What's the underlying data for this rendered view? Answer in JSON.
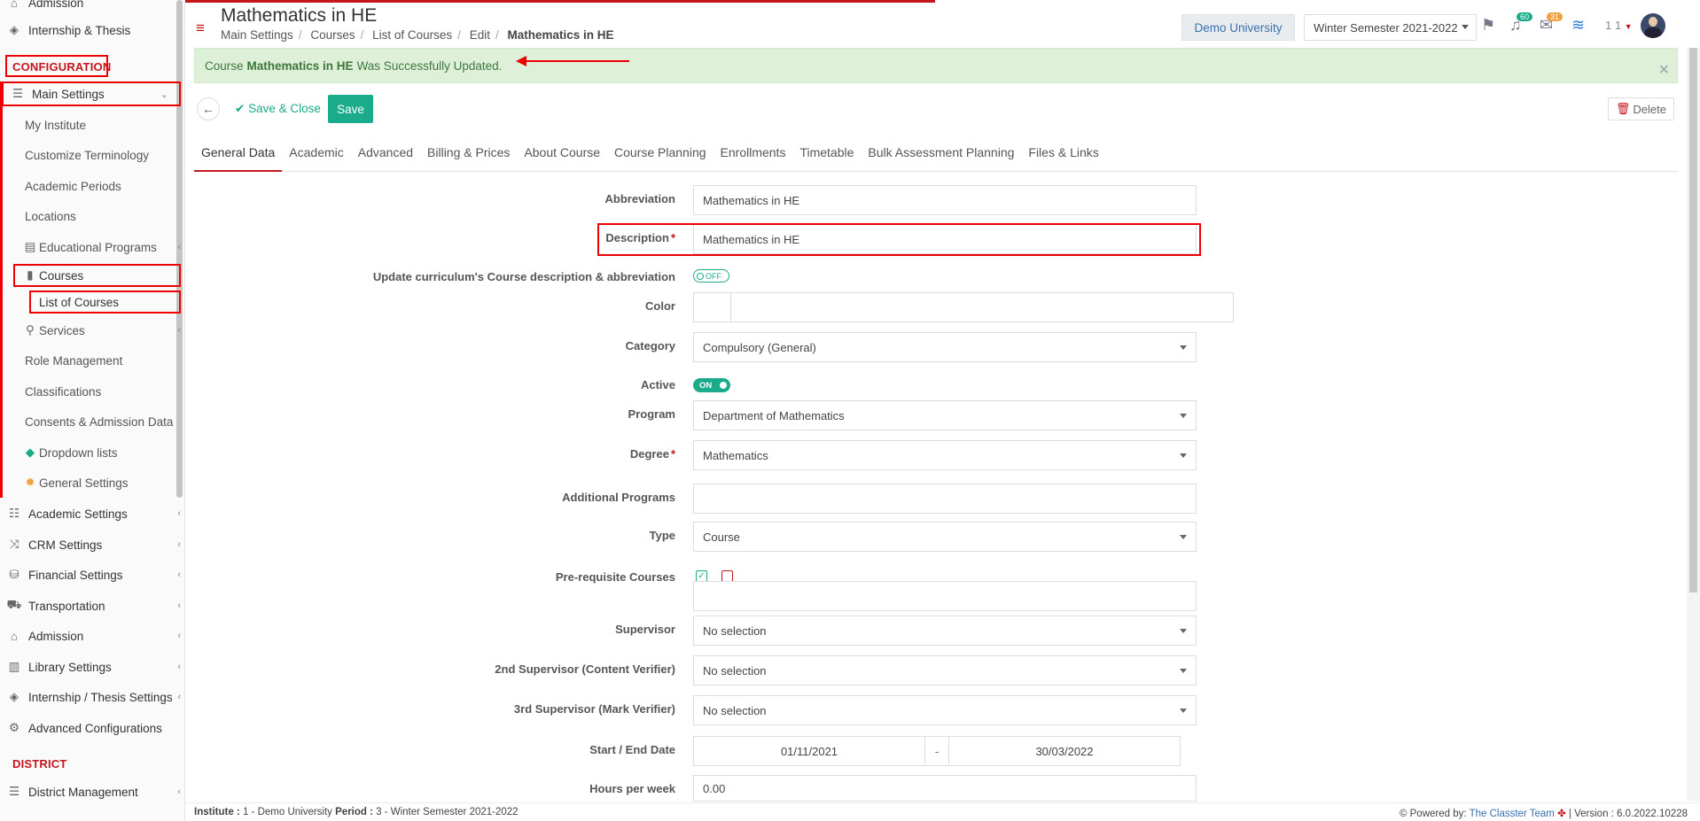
{
  "sidebar": {
    "top_partial": "Admission",
    "internship_thesis": "Internship & Thesis",
    "config_heading": "CONFIGURATION",
    "main_settings": "Main Settings",
    "items": {
      "my_institute": "My Institute",
      "customize_terminology": "Customize Terminology",
      "academic_periods": "Academic Periods",
      "locations": "Locations",
      "educational_programs": "Educational Programs",
      "courses": "Courses",
      "list_of_courses": "List of Courses",
      "services": "Services",
      "role_management": "Role Management",
      "classifications": "Classifications",
      "consents": "Consents & Admission Data",
      "dropdown_lists": "Dropdown lists",
      "general_settings": "General Settings"
    },
    "groups": {
      "academic_settings": "Academic Settings",
      "crm_settings": "CRM Settings",
      "financial_settings": "Financial Settings",
      "transportation": "Transportation",
      "admission": "Admission",
      "library_settings": "Library Settings",
      "internship_thesis_settings": "Internship / Thesis Settings",
      "advanced_configurations": "Advanced Configurations"
    },
    "district_heading": "DISTRICT",
    "district_management": "District Management"
  },
  "header": {
    "title": "Mathematics in HE",
    "breadcrumb": [
      "Main Settings",
      "Courses",
      "List of Courses",
      "Edit",
      "Mathematics in HE"
    ],
    "university": "Demo University",
    "semester": "Winter Semester 2021-2022",
    "notif_count": "60",
    "mail_count": "31",
    "user_label": "1 1"
  },
  "alert": {
    "prefix": "Course",
    "course": "Mathematics in HE",
    "suffix": "Was Successfully Updated."
  },
  "actions": {
    "save_close": "Save & Close",
    "save": "Save",
    "delete": "Delete"
  },
  "tabs": [
    "General Data",
    "Academic",
    "Advanced",
    "Billing & Prices",
    "About Course",
    "Course Planning",
    "Enrollments",
    "Timetable",
    "Bulk Assessment Planning",
    "Files & Links"
  ],
  "form": {
    "abbreviation": {
      "label": "Abbreviation",
      "value": "Mathematics in HE"
    },
    "description": {
      "label": "Description",
      "value": "Mathematics in HE"
    },
    "update_curriculum": {
      "label": "Update curriculum's Course description & abbreviation",
      "state": "OFF"
    },
    "color": {
      "label": "Color"
    },
    "category": {
      "label": "Category",
      "value": "Compulsory (General)"
    },
    "active": {
      "label": "Active",
      "state": "ON"
    },
    "program": {
      "label": "Program",
      "value": "Department of Mathematics"
    },
    "degree": {
      "label": "Degree",
      "value": "Mathematics"
    },
    "additional_programs": {
      "label": "Additional Programs",
      "value": ""
    },
    "type": {
      "label": "Type",
      "value": "Course"
    },
    "prerequisite": {
      "label": "Pre-requisite Courses"
    },
    "supervisor": {
      "label": "Supervisor",
      "value": "No selection"
    },
    "supervisor2": {
      "label": "2nd Supervisor (Content Verifier)",
      "value": "No selection"
    },
    "supervisor3": {
      "label": "3rd Supervisor (Mark Verifier)",
      "value": "No selection"
    },
    "dates": {
      "label": "Start / End Date",
      "start": "01/11/2021",
      "sep": "-",
      "end": "30/03/2022"
    },
    "hours": {
      "label": "Hours per week",
      "value": "0.00"
    }
  },
  "footer": {
    "institute_label": "Institute :",
    "institute_value": "1 - Demo University",
    "period_label": "Period :",
    "period_value": "3 - Winter Semester 2021-2022",
    "powered": "Powered by:",
    "team": "The Classter Team",
    "version": "| Version : 6.0.2022.10228"
  },
  "colors": {
    "brand_red": "#c4161c",
    "accent_green": "#1aab8a",
    "alert_bg": "#dff0d8",
    "link_blue": "#3a6fb0"
  }
}
